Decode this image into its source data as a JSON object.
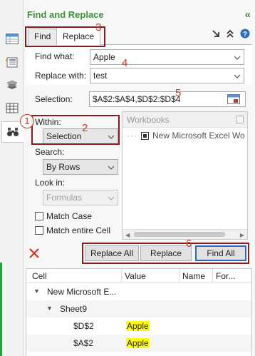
{
  "panel": {
    "title": "Find and Replace"
  },
  "tabs": [
    {
      "label": "Find"
    },
    {
      "label": "Replace"
    }
  ],
  "form": {
    "find_label": "Find what:",
    "find_value": "Apple",
    "replace_label": "Replace with:",
    "replace_value": "test",
    "selection_label": "Selection:",
    "selection_value": "$A$2:$A$4,$D$2:$D$4"
  },
  "options": {
    "within_label": "Within:",
    "within_value": "Selection",
    "search_label": "Search:",
    "search_value": "By Rows",
    "lookin_label": "Look in:",
    "lookin_value": "Formulas",
    "match_case": "Match Case",
    "match_entire": "Match entire Cell"
  },
  "workbooks": {
    "header": "Workbooks",
    "item": "New Microsoft Excel Wo"
  },
  "buttons": {
    "replace_all": "Replace All",
    "replace": "Replace",
    "find_all": "Find All"
  },
  "results": {
    "columns": [
      "Cell",
      "Value",
      "Name",
      "For..."
    ],
    "workbook": "New Microsoft E...",
    "sheet": "Sheet9",
    "rows": [
      {
        "cell": "$D$2",
        "value": "Apple"
      },
      {
        "cell": "$A$2",
        "value": "Apple"
      }
    ]
  },
  "annotations": [
    "1",
    "2",
    "3",
    "4",
    "5",
    "6"
  ],
  "icons": {
    "rail": [
      "worksheet-icon",
      "name-manager-icon",
      "layers-icon",
      "columns-grid-icon",
      "binoculars-icon"
    ],
    "collapse": "double-chevron-left-icon",
    "tabbar": [
      "arrow-down-right-icon",
      "collapse-up-icon",
      "help-icon"
    ],
    "clear": "red-x-icon",
    "selection_picker": "range-select-icon"
  },
  "colors": {
    "accent_green": "#3f8f3f",
    "annotation_red": "#c0392b",
    "highlight_yellow": "#ffff00",
    "primary_border": "#2b6bc4"
  }
}
